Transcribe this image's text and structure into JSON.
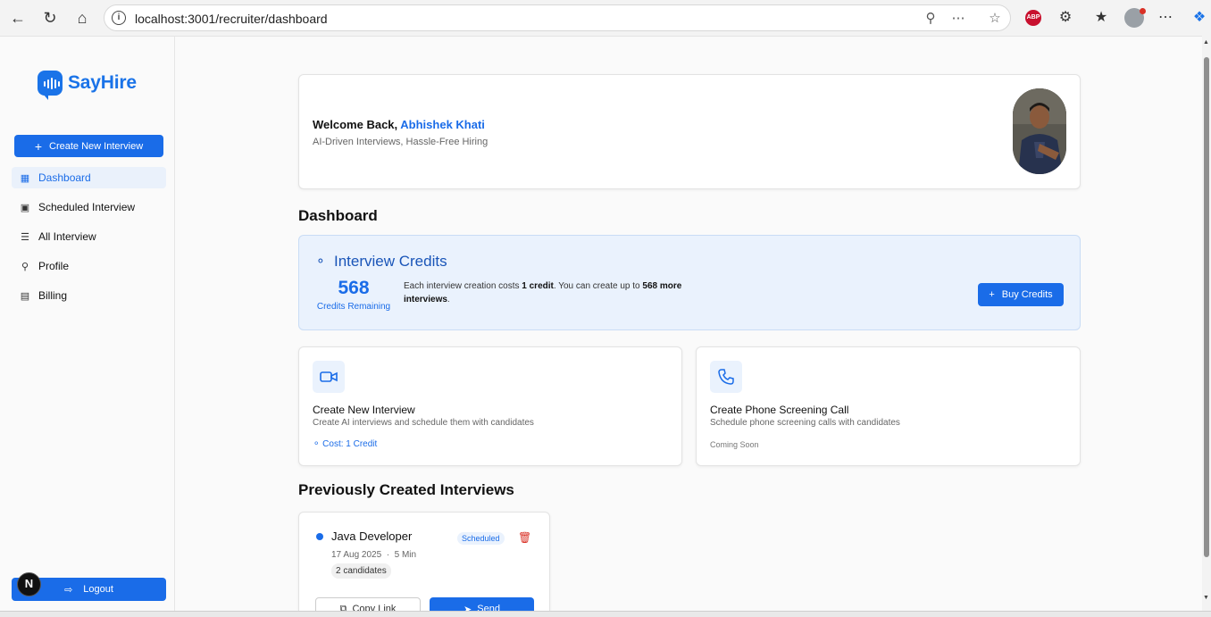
{
  "browser": {
    "url": "localhost:3001/recruiter/dashboard"
  },
  "brand": {
    "name": "SayHire",
    "color": "#1a6ce8"
  },
  "sidebar": {
    "create_label": "Create New Interview",
    "items": [
      {
        "label": "Dashboard",
        "icon": "grid-icon",
        "active": true
      },
      {
        "label": "Scheduled Interview",
        "icon": "calendar-icon"
      },
      {
        "label": "All Interview",
        "icon": "list-icon"
      },
      {
        "label": "Profile",
        "icon": "user-icon"
      },
      {
        "label": "Billing",
        "icon": "wallet-icon"
      }
    ],
    "logout_label": "Logout",
    "dev_badge": "N"
  },
  "welcome": {
    "greeting": "Welcome Back,",
    "name": "Abhishek Khati",
    "tagline": "AI-Driven Interviews, Hassle-Free Hiring"
  },
  "dashboard": {
    "heading": "Dashboard"
  },
  "credits": {
    "title": "Interview Credits",
    "remaining": "568",
    "remaining_label": "Credits Remaining",
    "desc_pre": "Each interview creation costs ",
    "desc_cost": "1 credit",
    "desc_mid": ". You can create up to ",
    "desc_count": "568 more interviews",
    "desc_end": ".",
    "buy_label": "Buy Credits"
  },
  "features": [
    {
      "title": "Create New Interview",
      "desc": "Create AI interviews and schedule them with candidates",
      "note": "Cost: 1 Credit",
      "icon": "video-icon"
    },
    {
      "title": "Create Phone Screening Call",
      "desc": "Schedule phone screening calls with candidates",
      "note": "Coming Soon",
      "icon": "phone-icon"
    }
  ],
  "previous": {
    "heading": "Previously Created Interviews",
    "interviews": [
      {
        "title": "Java Developer",
        "status": "Scheduled",
        "date": "17 Aug 2025",
        "duration": "5 Min",
        "candidates": "2 candidates",
        "copy_label": "Copy Link",
        "send_label": "Send"
      }
    ]
  }
}
